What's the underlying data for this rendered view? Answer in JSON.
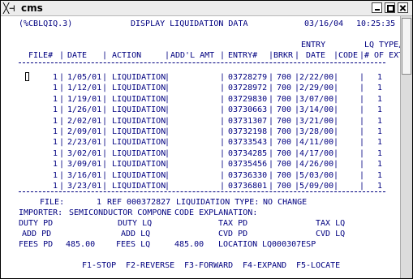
{
  "window": {
    "title": "cms",
    "system_menu_glyph": "╳⊣"
  },
  "header": {
    "program": "(%CBLQIQ.3)",
    "screen_title": "DISPLAY LIQUIDATION DATA",
    "date": "03/16/04",
    "time": "10:25:35"
  },
  "columns": {
    "line1": {
      "entry": "ENTRY",
      "lq_type": "LQ TYPE/"
    },
    "file": "FILE#",
    "date": "DATE",
    "action": "ACTION",
    "addl_amt": "ADD'L AMT",
    "entry_no": "ENTRY#",
    "brkr": "BRKR",
    "entry_date": "DATE",
    "code": "CODE",
    "num_exts": "# OF EXTS"
  },
  "rows": [
    {
      "file": "1",
      "date": "1/05/01",
      "action": "LIQUIDATION",
      "entry_no": "03728279",
      "brkr": "700",
      "entry_date": "2/22/00",
      "lq_type": "1"
    },
    {
      "file": "1",
      "date": "1/12/01",
      "action": "LIQUIDATION",
      "entry_no": "03728972",
      "brkr": "700",
      "entry_date": "2/29/00",
      "lq_type": "1"
    },
    {
      "file": "1",
      "date": "1/19/01",
      "action": "LIQUIDATION",
      "entry_no": "03729830",
      "brkr": "700",
      "entry_date": "3/07/00",
      "lq_type": "1"
    },
    {
      "file": "1",
      "date": "1/26/01",
      "action": "LIQUIDATION",
      "entry_no": "03730663",
      "brkr": "700",
      "entry_date": "3/14/00",
      "lq_type": "1"
    },
    {
      "file": "1",
      "date": "2/02/01",
      "action": "LIQUIDATION",
      "entry_no": "03731307",
      "brkr": "700",
      "entry_date": "3/21/00",
      "lq_type": "1"
    },
    {
      "file": "1",
      "date": "2/09/01",
      "action": "LIQUIDATION",
      "entry_no": "03732198",
      "brkr": "700",
      "entry_date": "3/28/00",
      "lq_type": "1"
    },
    {
      "file": "1",
      "date": "2/23/01",
      "action": "LIQUIDATION",
      "entry_no": "03733543",
      "brkr": "700",
      "entry_date": "4/11/00",
      "lq_type": "1"
    },
    {
      "file": "1",
      "date": "3/02/01",
      "action": "LIQUIDATION",
      "entry_no": "03734285",
      "brkr": "700",
      "entry_date": "4/17/00",
      "lq_type": "1"
    },
    {
      "file": "1",
      "date": "3/09/01",
      "action": "LIQUIDATION",
      "entry_no": "03735456",
      "brkr": "700",
      "entry_date": "4/26/00",
      "lq_type": "1"
    },
    {
      "file": "1",
      "date": "3/16/01",
      "action": "LIQUIDATION",
      "entry_no": "03736330",
      "brkr": "700",
      "entry_date": "5/03/00",
      "lq_type": "1"
    },
    {
      "file": "1",
      "date": "3/23/01",
      "action": "LIQUIDATION",
      "entry_no": "03736801",
      "brkr": "700",
      "entry_date": "5/09/00",
      "lq_type": "1"
    }
  ],
  "detail": {
    "file_label": "FILE:",
    "file_value": "1",
    "ref_label": "REF",
    "ref_value": "000372827",
    "liq_type_label": "LIQUIDATION TYPE:",
    "liq_type_value": "NO CHANGE",
    "importer_label": "IMPORTER:",
    "importer_value": "SEMICONDUCTOR COMPONE",
    "code_expl_label": "CODE EXPLANATION:",
    "duty_pd": "DUTY PD",
    "duty_lq": "DUTY LQ",
    "tax_pd": "TAX PD",
    "tax_lq": "TAX LQ",
    "add_pd": "ADD PD",
    "add_lq": "ADD LQ",
    "cvd_pd": "CVD PD",
    "cvd_lq": "CVD LQ",
    "fees_pd": "FEES PD",
    "fees_pd_value": "485.00",
    "fees_lq": "FEES LQ",
    "fees_lq_value": "485.00",
    "location_label": "LOCATION",
    "location_value": "LQ000307ESP"
  },
  "function_keys": [
    "F1-STOP",
    "F2-REVERSE",
    "F3-FORWARD",
    "F4-EXPAND",
    "F5-LOCATE"
  ],
  "colors": {
    "terminal_text": "#000080",
    "background": "#ffffff"
  }
}
